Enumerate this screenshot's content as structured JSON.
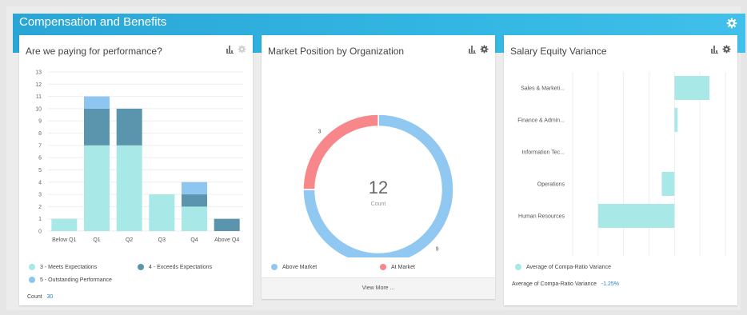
{
  "banner": {
    "title": "Compensation and Benefits"
  },
  "colors": {
    "meets": "#a8e8e6",
    "exceeds": "#5b95ad",
    "outstanding": "#8ec6f2",
    "above_market": "#91c8f2",
    "at_market": "#f7878a",
    "equity_bar": "#a8e8e6",
    "accent": "#2aa6d6"
  },
  "perf": {
    "title": "Are we paying for performance?",
    "legend": [
      "3 - Meets Expectations",
      "4 - Exceeds Expectations",
      "5 - Outstanding Performance"
    ],
    "count_label": "Count",
    "count_value": "30"
  },
  "market": {
    "title": "Market Position by Organization",
    "center_value": "12",
    "center_label": "Count",
    "legend": [
      "Above Market",
      "At Market"
    ],
    "view_more": "View More ..."
  },
  "equity": {
    "title": "Salary Equity Variance",
    "legend": [
      "Average of Compa-Ratio Variance"
    ],
    "summary_label": "Average of Compa-Ratio Variance",
    "summary_value": "-1.25%"
  },
  "chart_data": [
    {
      "type": "bar",
      "stacked": true,
      "categories": [
        "Below Q1",
        "Q1",
        "Q2",
        "Q3",
        "Q4",
        "Above Q4"
      ],
      "series": [
        {
          "name": "3 - Meets Expectations",
          "values": [
            1,
            7,
            7,
            3,
            2,
            0
          ]
        },
        {
          "name": "4 - Exceeds Expectations",
          "values": [
            0,
            3,
            3,
            0,
            1,
            1
          ]
        },
        {
          "name": "5 - Outstanding Performance",
          "values": [
            0,
            1,
            0,
            0,
            1,
            0
          ]
        }
      ],
      "ylim": [
        0,
        13
      ],
      "yticks": [
        0,
        1,
        2,
        3,
        4,
        5,
        6,
        7,
        8,
        9,
        10,
        11,
        12,
        13
      ],
      "grid": true
    },
    {
      "type": "pie",
      "donut": true,
      "labels": [
        "Above Market",
        "At Market"
      ],
      "values": [
        9,
        3
      ]
    },
    {
      "type": "bar",
      "orientation": "horizontal",
      "categories": [
        "Sales & Marketi...",
        "Finance & Admin...",
        "Information Tec...",
        "Operations",
        "Human Resources"
      ],
      "series": [
        {
          "name": "Average of Compa-Ratio Variance",
          "values": [
            5.5,
            0.5,
            0.0,
            -2.0,
            -12.0
          ]
        }
      ],
      "xlim": [
        -16,
        8
      ],
      "xticks": [
        "-16.00%",
        "12.00%",
        "-8.00%",
        "-4.00%",
        "0.00%",
        "4.00%",
        "8.00%"
      ],
      "grid": true
    }
  ]
}
